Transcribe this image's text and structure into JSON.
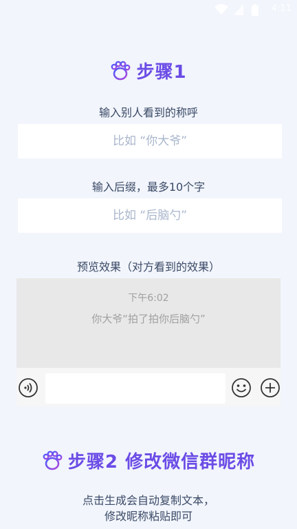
{
  "status_bar": {
    "time": "4:11"
  },
  "step1": {
    "heading": "步骤1",
    "nickname_label": "输入别人看到的称呼",
    "nickname_placeholder": "比如 “你大爷”",
    "suffix_label": "输入后缀，最多10个字",
    "suffix_placeholder": "比如 “后脑勺”",
    "preview_label": "预览效果（对方看到的效果）",
    "preview": {
      "time": "下午6:02",
      "message": "你大爷“拍了拍你后脑勺”"
    }
  },
  "step2": {
    "heading": "步骤2 修改微信群昵称",
    "description_line1": "点击生成会自动复制文本，",
    "description_line2": "修改昵称粘贴即可"
  },
  "colors": {
    "accent_purple": "#6b4ce6",
    "page_background": "#f2f5fc",
    "label_text": "#3a4a66",
    "placeholder_text": "#a9b6cc"
  },
  "icons": [
    "wifi-icon",
    "signal-icon",
    "battery-icon",
    "paw-icon",
    "voice-icon",
    "emoji-icon",
    "plus-icon"
  ]
}
